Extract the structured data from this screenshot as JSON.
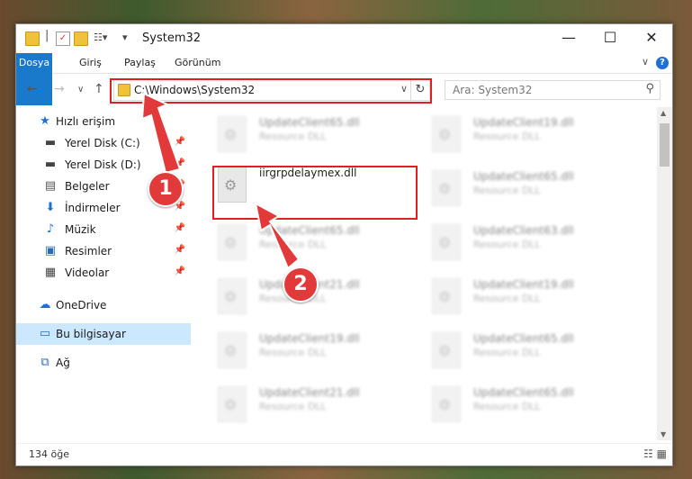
{
  "window": {
    "title": "System32"
  },
  "ribbon": {
    "tabs": [
      "Dosya",
      "Giriş",
      "Paylaş",
      "Görünüm"
    ]
  },
  "address": {
    "path": "C:\\Windows\\System32",
    "search_placeholder": "Ara: System32"
  },
  "sidebar": {
    "items": [
      {
        "label": "Hızlı erişim",
        "icon": "star-icon"
      },
      {
        "label": "Yerel Disk (C:)",
        "icon": "drive-icon"
      },
      {
        "label": "Yerel Disk (D:)",
        "icon": "drive-icon"
      },
      {
        "label": "Belgeler",
        "icon": "document-icon"
      },
      {
        "label": "İndirmeler",
        "icon": "download-icon"
      },
      {
        "label": "Müzik",
        "icon": "music-icon"
      },
      {
        "label": "Resimler",
        "icon": "picture-icon"
      },
      {
        "label": "Videolar",
        "icon": "video-icon"
      },
      {
        "label": "OneDrive",
        "icon": "cloud-icon"
      },
      {
        "label": "Bu bilgisayar",
        "icon": "computer-icon"
      },
      {
        "label": "Ağ",
        "icon": "network-icon"
      }
    ]
  },
  "files": {
    "left": [
      {
        "name": "UpdateClient65.dll",
        "desc": "Resource DLL"
      },
      {
        "name": "iirgrpdelaymex.dll",
        "desc": ""
      },
      {
        "name": "UpdateClient65.dll",
        "desc": "Resource DLL"
      },
      {
        "name": "UpdateClient21.dll",
        "desc": "Resource DLL"
      },
      {
        "name": "UpdateClient19.dll",
        "desc": "Resource DLL"
      },
      {
        "name": "UpdateClient21.dll",
        "desc": "Resource DLL"
      }
    ],
    "right": [
      {
        "name": "UpdateClient19.dll",
        "desc": "Resource DLL"
      },
      {
        "name": "UpdateClient65.dll",
        "desc": "Resource DLL"
      },
      {
        "name": "UpdateClient63.dll",
        "desc": "Resource DLL"
      },
      {
        "name": "UpdateClient19.dll",
        "desc": "Resource DLL"
      },
      {
        "name": "UpdateClient65.dll",
        "desc": "Resource DLL"
      },
      {
        "name": "UpdateClient65.dll",
        "desc": "Resource DLL"
      }
    ]
  },
  "status": {
    "count": "134 öğe"
  },
  "annotations": {
    "marker1": "1",
    "marker2": "2",
    "highlight_color": "#e02020"
  }
}
